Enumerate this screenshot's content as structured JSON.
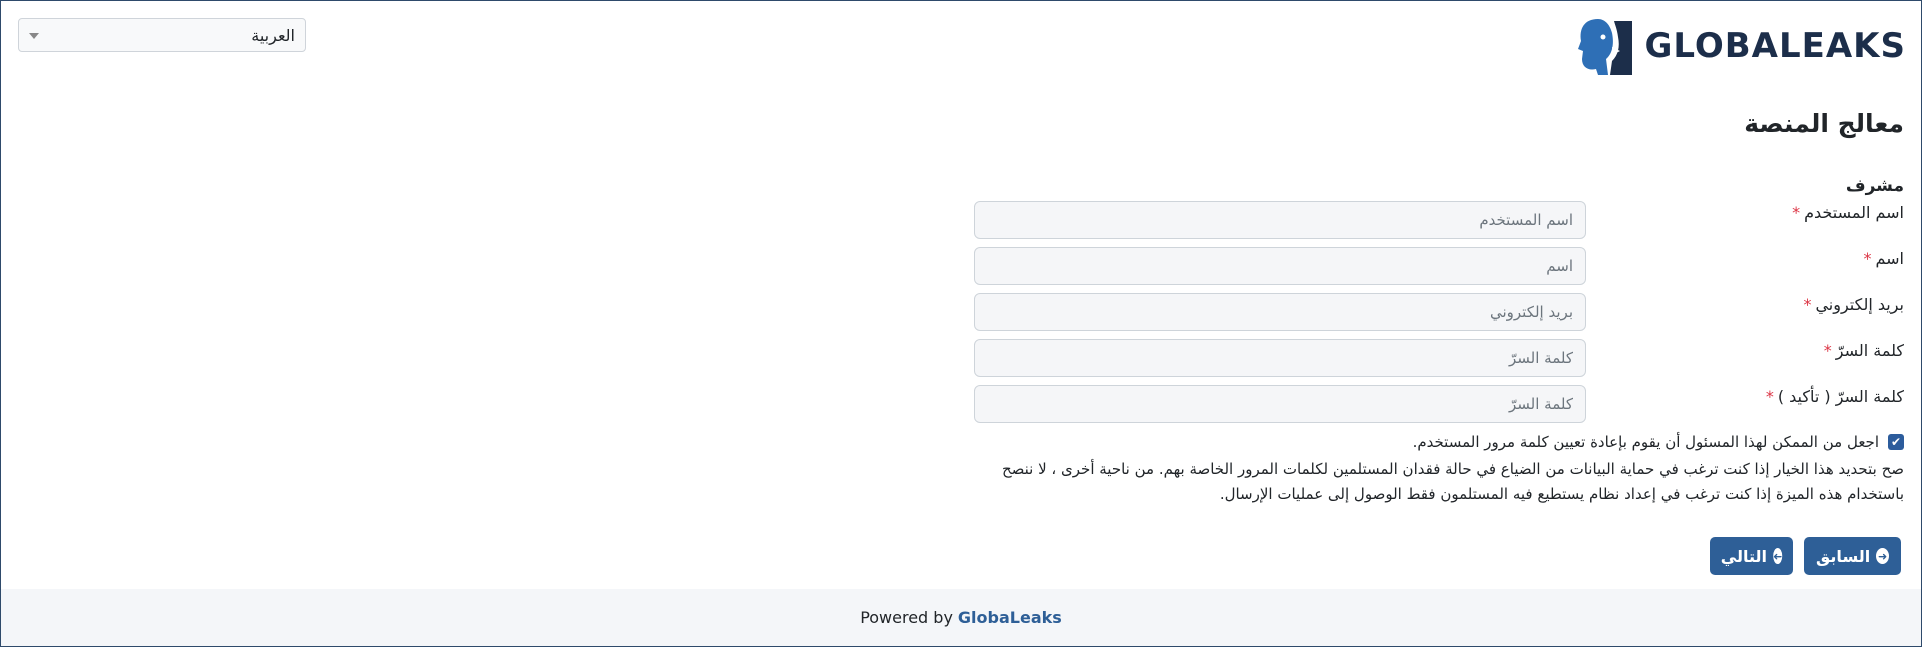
{
  "language_select": {
    "selected": "العربية"
  },
  "logo": {
    "text": "GLOBALEAKS"
  },
  "wizard": {
    "title": "معالج المنصة",
    "section": "مشرف",
    "fields": [
      {
        "label": "اسم المستخدم",
        "placeholder": "اسم المستخدم",
        "required": "*"
      },
      {
        "label": "اسم",
        "placeholder": "اسم",
        "required": "*"
      },
      {
        "label": "بريد إلكتروني",
        "placeholder": "بريد إلكتروني",
        "required": "*"
      },
      {
        "label": "كلمة السرّ",
        "placeholder": "كلمة السرّ",
        "required": "*"
      },
      {
        "label": "كلمة السرّ ( تأكيد )",
        "placeholder": "كلمة السرّ",
        "required": "*"
      }
    ],
    "checkbox": {
      "checked": true,
      "label": "اجعل من الممكن لهذا المسئول أن يقوم بإعادة تعيين كلمة مرور المستخدم."
    },
    "help_text": "صح بتحديد هذا الخيار إذا كنت ترغب في حماية البيانات من الضياع في حالة فقدان المستلمين لكلمات المرور الخاصة بهم. من ناحية أخرى ، لا ننصح باستخدام هذه الميزة إذا كنت ترغب في إعداد نظام يستطيع فيه المستلمون فقط الوصول إلى عمليات الإرسال.",
    "buttons": {
      "previous": "السابق",
      "next": "التالي"
    }
  },
  "footer": {
    "prefix": "Powered by",
    "link": "GlobaLeaks"
  },
  "colors": {
    "primary": "#2e5f97",
    "required": "#dc3545",
    "brand_text": "#1c2e4a"
  }
}
